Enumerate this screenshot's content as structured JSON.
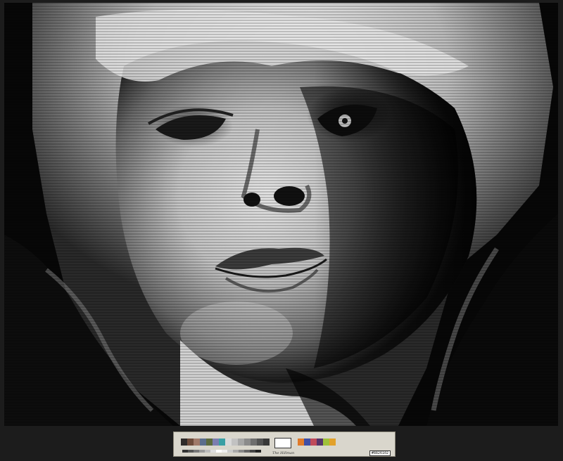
{
  "photo": {
    "subject": "portrait-face-closeup",
    "style": "black-and-white halftone scan-line print"
  },
  "calibration_target": {
    "brand_text": "The Hillman",
    "id_text": "#8826102",
    "colors": {
      "card": "#d9d6cc",
      "top_patches": [
        "#2e2b2a",
        "#6d4b3b",
        "#a07a6a",
        "#5b6e8c",
        "#5c6b3e",
        "#7c7eb0",
        "#3aa0a4",
        "#d9d9d9",
        "#c2c2c2",
        "#a6a6a6",
        "#8b8b8b",
        "#6e6e6e",
        "#525252",
        "#383838",
        "#e07a2a",
        "#3e4ea6",
        "#c04a5a",
        "#55346a",
        "#9ec03a",
        "#e2a12a"
      ],
      "bottom_patches": [
        "#333",
        "#555",
        "#777",
        "#999",
        "#bbb",
        "#ddd",
        "#fff",
        "#eee",
        "#ccc",
        "#aaa",
        "#888",
        "#666",
        "#444",
        "#222"
      ]
    }
  }
}
